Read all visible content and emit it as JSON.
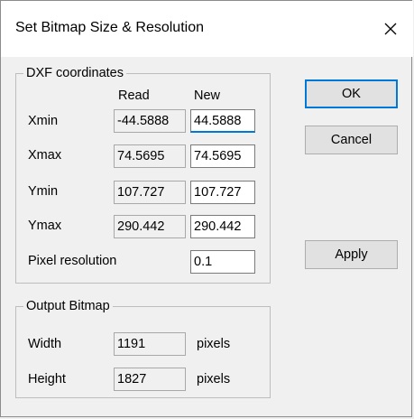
{
  "window": {
    "title": "Set Bitmap Size & Resolution",
    "close_glyph": "✕"
  },
  "dxf": {
    "group_label": "DXF coordinates",
    "col_read": "Read",
    "col_new": "New",
    "rows": [
      {
        "label": "Xmin",
        "read": "-44.5888",
        "new": "44.5888"
      },
      {
        "label": "Xmax",
        "read": "74.5695",
        "new": "74.5695"
      },
      {
        "label": "Ymin",
        "read": "107.727",
        "new": "107.727"
      },
      {
        "label": "Ymax",
        "read": "290.442",
        "new": "290.442"
      }
    ],
    "pixel_resolution": {
      "label": "Pixel resolution",
      "value": "0.1"
    }
  },
  "output": {
    "group_label": "Output Bitmap",
    "width": {
      "label": "Width",
      "value": "1191",
      "unit": "pixels"
    },
    "height": {
      "label": "Height",
      "value": "1827",
      "unit": "pixels"
    }
  },
  "buttons": {
    "ok": "OK",
    "cancel": "Cancel",
    "apply": "Apply"
  }
}
